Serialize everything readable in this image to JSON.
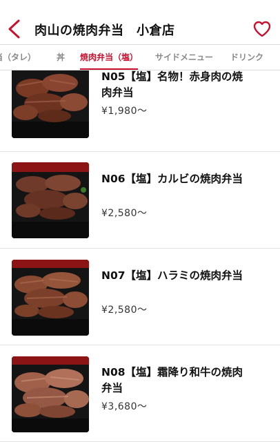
{
  "header": {
    "title": "肉山の焼肉弁当　小倉店",
    "back_icon": "chevron-left-icon",
    "favorite_icon": "heart-icon",
    "accent_color": "#c8102e"
  },
  "tabs": [
    {
      "label": "当（タレ）",
      "active": false
    },
    {
      "label": "丼",
      "active": false
    },
    {
      "label": "焼肉弁当（塩）",
      "active": true
    },
    {
      "label": "サイドメニュー",
      "active": false
    },
    {
      "label": "ドリンク",
      "active": false
    }
  ],
  "items": [
    {
      "title": "N05【塩】名物！赤身肉の焼肉弁当",
      "price": "¥1,980～"
    },
    {
      "title": "N06【塩】カルビの焼肉弁当",
      "price": "¥2,580～"
    },
    {
      "title": "N07【塩】ハラミの焼肉弁当",
      "price": "¥2,580～"
    },
    {
      "title": "N08【塩】霜降り和牛の焼肉弁当",
      "price": "¥3,680～"
    }
  ]
}
